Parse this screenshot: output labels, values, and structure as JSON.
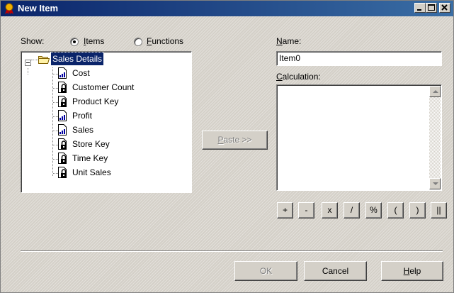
{
  "window": {
    "title": "New Item"
  },
  "show": {
    "label": "Show:",
    "options": [
      {
        "accel": "I",
        "rest": "tems",
        "selected": true
      },
      {
        "accel": "F",
        "rest": "unctions",
        "selected": false
      }
    ]
  },
  "tree": {
    "root": {
      "label": "Sales Details",
      "icon": "folder-icon"
    },
    "items": [
      {
        "label": "Cost",
        "icon": "measure-icon"
      },
      {
        "label": "Customer Count",
        "icon": "key-dimension-icon"
      },
      {
        "label": "Product Key",
        "icon": "key-dimension-icon"
      },
      {
        "label": "Profit",
        "icon": "measure-icon"
      },
      {
        "label": "Sales",
        "icon": "measure-icon"
      },
      {
        "label": "Store Key",
        "icon": "key-dimension-icon"
      },
      {
        "label": "Time Key",
        "icon": "key-dimension-icon"
      },
      {
        "label": "Unit Sales",
        "icon": "key-dimension-icon"
      }
    ]
  },
  "paste_button": {
    "accel": "P",
    "rest": "aste >>"
  },
  "name_field": {
    "label_accel": "N",
    "label_rest": "ame:",
    "value": "Item0"
  },
  "calculation": {
    "label_accel": "C",
    "label_rest": "alculation:",
    "value": ""
  },
  "operators": [
    "+",
    "-",
    "x",
    "/",
    "%",
    "(",
    ")",
    "||"
  ],
  "footer": {
    "ok_label": "OK",
    "cancel_label": "Cancel",
    "help_accel": "H",
    "help_rest": "elp"
  },
  "colors": {
    "title_bar": "#0a246a",
    "selection": "#0a246a",
    "face": "#d4d0c8"
  }
}
